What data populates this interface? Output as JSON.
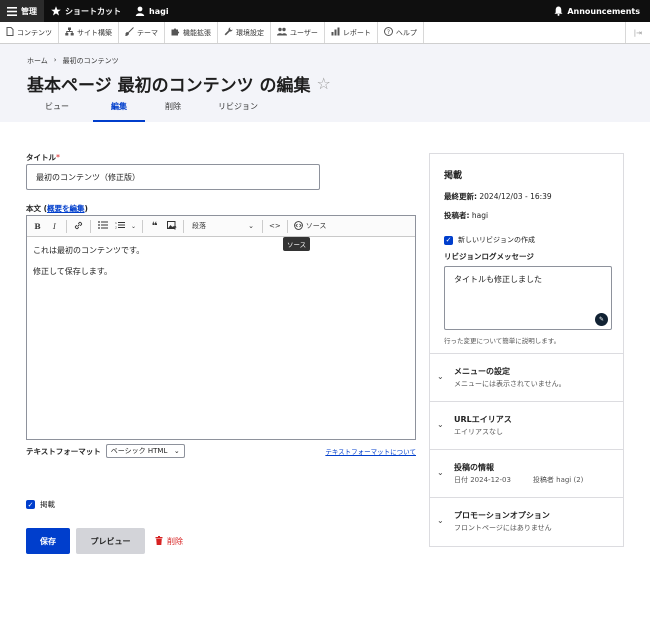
{
  "toolbar": {
    "manage": "管理",
    "shortcuts": "ショートカット",
    "user": "hagi",
    "announcements": "Announcements"
  },
  "tray": {
    "items": [
      "コンテンツ",
      "サイト構築",
      "テーマ",
      "機能拡張",
      "環境設定",
      "ユーザー",
      "レポート",
      "ヘルプ"
    ]
  },
  "header": {
    "breadcrumb": [
      "ホーム",
      "最初のコンテンツ"
    ],
    "title": "基本ページ 最初のコンテンツ の編集",
    "tabs": [
      "ビュー",
      "編集",
      "削除",
      "リビジョン"
    ]
  },
  "form": {
    "title_label": "タイトル",
    "title_value": "最初のコンテンツ（修正版）",
    "body_label": "本文 (",
    "summary_link": "概要を編集",
    "body_label_close": ")",
    "editor": {
      "paragraph_select": "段落",
      "source_label": "ソース",
      "tooltip": "ソース",
      "paragraphs": [
        "これは最初のコンテンツです。",
        "修正して保存します。"
      ]
    },
    "text_format_label": "テキストフォーマット",
    "text_format_value": "ベーシック HTML",
    "text_format_link": "テキストフォーマットについて",
    "published_label": "掲載",
    "save_label": "保存",
    "preview_label": "プレビュー",
    "delete_label": "削除"
  },
  "sidebar": {
    "section_title": "掲載",
    "last_updated_label": "最終更新:",
    "last_updated_value": "2024/12/03 - 16:39",
    "author_label": "投稿者:",
    "author_value": "hagi",
    "new_revision_label": "新しいリビジョンの作成",
    "revision_log_label": "リビジョンログメッセージ",
    "revision_log_value": "タイトルも修正しました",
    "revision_help": "行った変更について簡単に説明します。",
    "accordions": [
      {
        "title": "メニューの設定",
        "sub": "メニューには表示されていません。"
      },
      {
        "title": "URLエイリアス",
        "sub": "エイリアスなし"
      },
      {
        "title": "投稿の情報",
        "sub": "日付 2024-12-03",
        "sub2": "投稿者 hagi (2)"
      },
      {
        "title": "プロモーションオプション",
        "sub": "フロントページにはありません"
      }
    ]
  },
  "colors": {
    "accent": "#003ecc",
    "danger": "#d72222",
    "toolbar": "#0f0f0f",
    "header_bg": "#f3f4f9"
  }
}
